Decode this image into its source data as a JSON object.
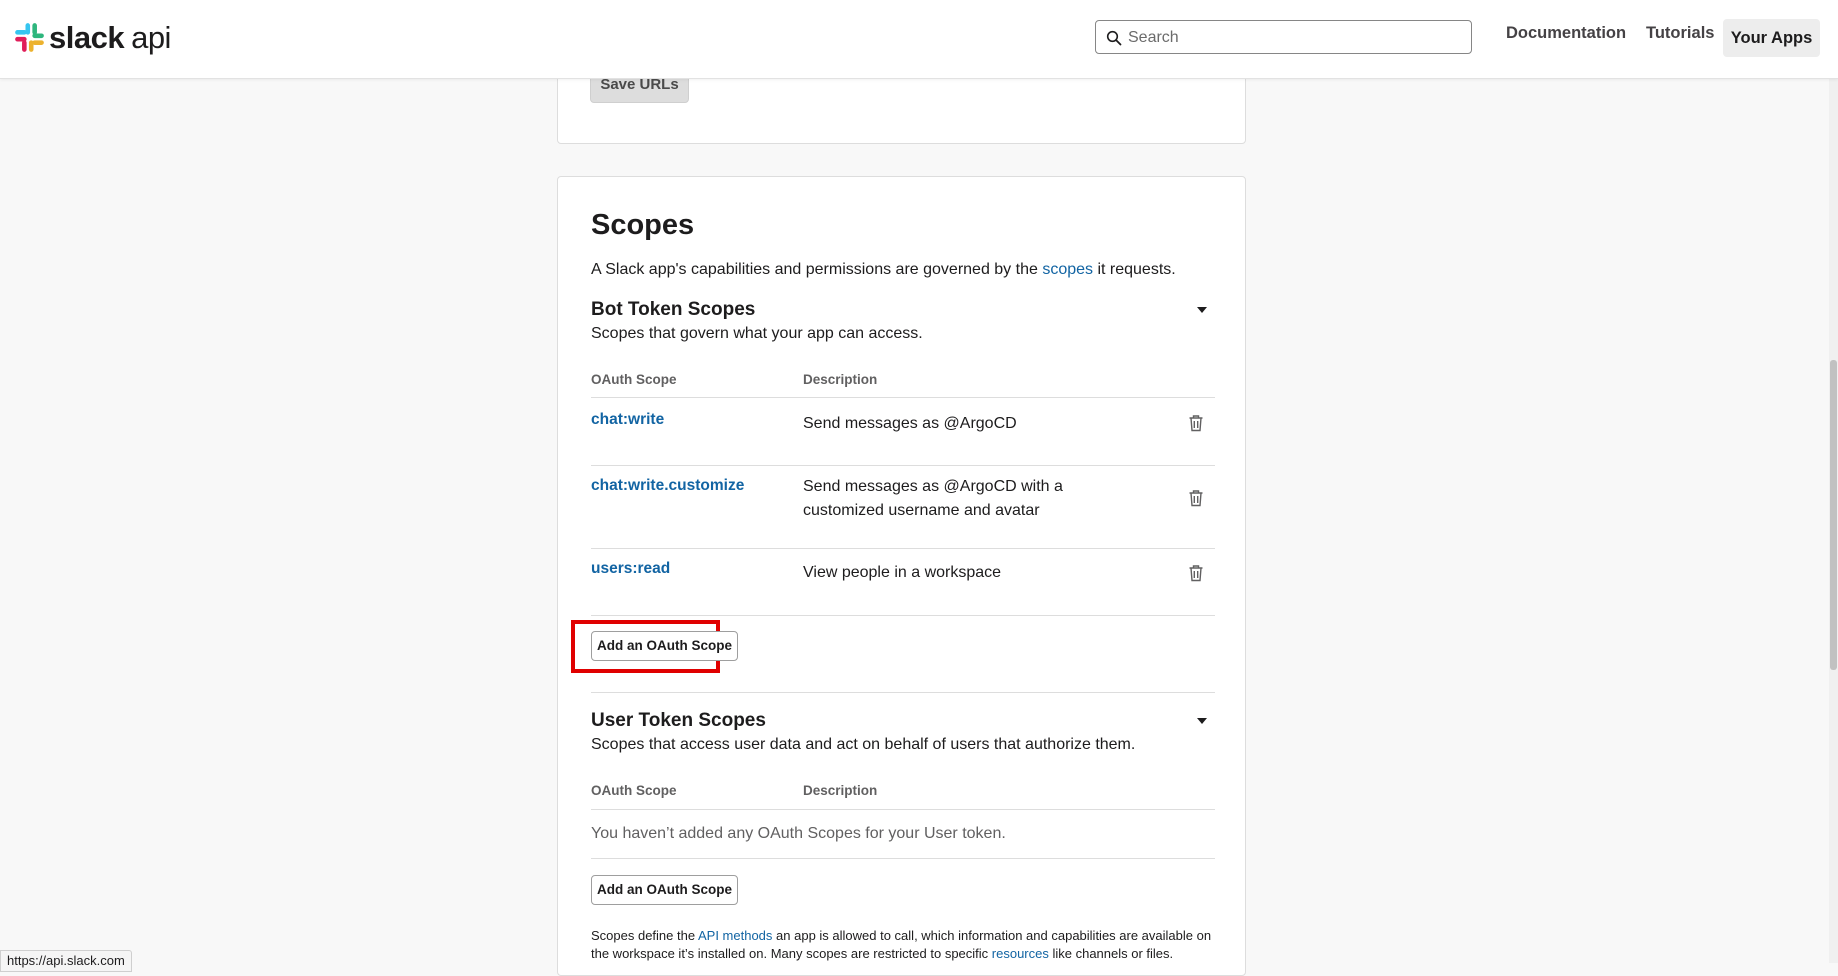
{
  "header": {
    "logo_word": "slack",
    "logo_suffix": "api",
    "search_placeholder": "Search",
    "nav": {
      "documentation": "Documentation",
      "tutorials": "Tutorials",
      "your_apps": "Your Apps"
    }
  },
  "top_card": {
    "save_urls_label": "Save URLs"
  },
  "scopes": {
    "title": "Scopes",
    "intro_before": "A Slack app's capabilities and permissions are governed by the ",
    "intro_link": "scopes",
    "intro_after": " it requests.",
    "bot": {
      "title": "Bot Token Scopes",
      "subtitle": "Scopes that govern what your app can access.",
      "col_scope": "OAuth Scope",
      "col_desc": "Description",
      "rows": [
        {
          "scope": "chat:write",
          "desc": "Send messages as @ArgoCD"
        },
        {
          "scope": "chat:write.customize",
          "desc": "Send messages as @ArgoCD with a customized username and avatar"
        },
        {
          "scope": "users:read",
          "desc": "View people in a workspace"
        }
      ],
      "add_label": "Add an OAuth Scope"
    },
    "user": {
      "title": "User Token Scopes",
      "subtitle": "Scopes that access user data and act on behalf of users that authorize them.",
      "col_scope": "OAuth Scope",
      "col_desc": "Description",
      "empty_text": "You haven’t added any OAuth Scopes for your User token.",
      "add_label": "Add an OAuth Scope"
    },
    "footer": {
      "part1": "Scopes define the ",
      "link1": "API methods",
      "part2": " an app is allowed to call, which information and capabilities are available on the workspace it’s installed on. Many scopes are restricted to specific ",
      "link2": "resources",
      "part3": " like channels or files."
    }
  },
  "status_bar": {
    "url": "https://api.slack.com"
  },
  "colors": {
    "link": "#1264a3",
    "highlight": "#e00000"
  }
}
